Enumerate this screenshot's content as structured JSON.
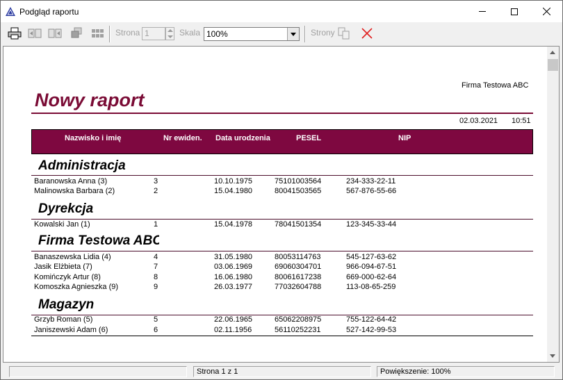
{
  "window": {
    "title": "Podgląd raportu"
  },
  "toolbar": {
    "page_label": "Strona",
    "page_value": "1",
    "scale_label": "Skala",
    "scale_value": "100%",
    "pages_label": "Strony"
  },
  "report": {
    "company": "Firma Testowa ABC",
    "title": "Nowy raport",
    "date": "02.03.2021",
    "time": "10:51",
    "columns": [
      "Nazwisko i imię",
      "Nr ewiden.",
      "Data urodzenia",
      "PESEL",
      "NIP"
    ],
    "groups": [
      {
        "name": "Administracja",
        "rows": [
          {
            "name": "Baranowska Anna (3)",
            "nr": "3",
            "date": "10.10.1975",
            "pesel": "75101003564",
            "nip": "234-333-22-11"
          },
          {
            "name": "Malinowska Barbara (2)",
            "nr": "2",
            "date": "15.04.1980",
            "pesel": "80041503565",
            "nip": "567-876-55-66"
          }
        ]
      },
      {
        "name": "Dyrekcja",
        "rows": [
          {
            "name": "Kowalski Jan (1)",
            "nr": "1",
            "date": "15.04.1978",
            "pesel": "78041501354",
            "nip": "123-345-33-44"
          }
        ]
      },
      {
        "name": "Firma Testowa ABC",
        "rows": [
          {
            "name": "Banaszewska Lidia (4)",
            "nr": "4",
            "date": "31.05.1980",
            "pesel": "80053114763",
            "nip": "545-127-63-62"
          },
          {
            "name": "Jasik Elżbieta (7)",
            "nr": "7",
            "date": "03.06.1969",
            "pesel": "69060304701",
            "nip": "966-094-67-51"
          },
          {
            "name": "Komińczyk  Artur (8)",
            "nr": "8",
            "date": "16.06.1980",
            "pesel": "80061617238",
            "nip": "669-000-62-64"
          },
          {
            "name": "Komoszka Agnieszka (9)",
            "nr": "9",
            "date": "26.03.1977",
            "pesel": "77032604788",
            "nip": "113-08-65-259"
          }
        ]
      },
      {
        "name": "Magazyn",
        "rows": [
          {
            "name": "Grzyb Roman (5)",
            "nr": "5",
            "date": "22.06.1965",
            "pesel": "65062208975",
            "nip": "755-122-64-42"
          },
          {
            "name": "Janiszewski Adam (6)",
            "nr": "6",
            "date": "02.11.1956",
            "pesel": "56110252231",
            "nip": "527-142-99-53"
          }
        ]
      }
    ]
  },
  "statusbar": {
    "left": "",
    "page_info": "Strona 1  z 1",
    "zoom_info": "Powiększenie: 100%"
  },
  "colors": {
    "accent": "#7e0840",
    "title": "#7a0b35"
  },
  "icons": [
    "app-triangle-icon",
    "print-icon",
    "first-page-icon",
    "prev-page-icon",
    "next-page-icon",
    "last-page-icon",
    "copy-pages-icon",
    "close-red-x-icon"
  ]
}
